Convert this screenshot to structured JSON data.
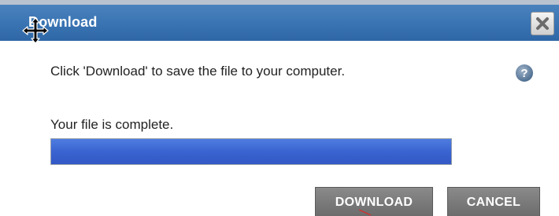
{
  "dialog": {
    "title": "Download",
    "message": "Click 'Download' to save the file to your computer.",
    "status": "Your file is complete.",
    "progress": 1.0,
    "buttons": {
      "download_label": "DOWNLOAD",
      "cancel_label": "CANCEL"
    },
    "icons": {
      "move": "move-cursor-icon",
      "close": "close-icon",
      "help": "help-icon"
    },
    "colors": {
      "titlebar": "#3973b2",
      "progress_fill": "#3a64d1",
      "button": "#7a7a7a"
    }
  }
}
